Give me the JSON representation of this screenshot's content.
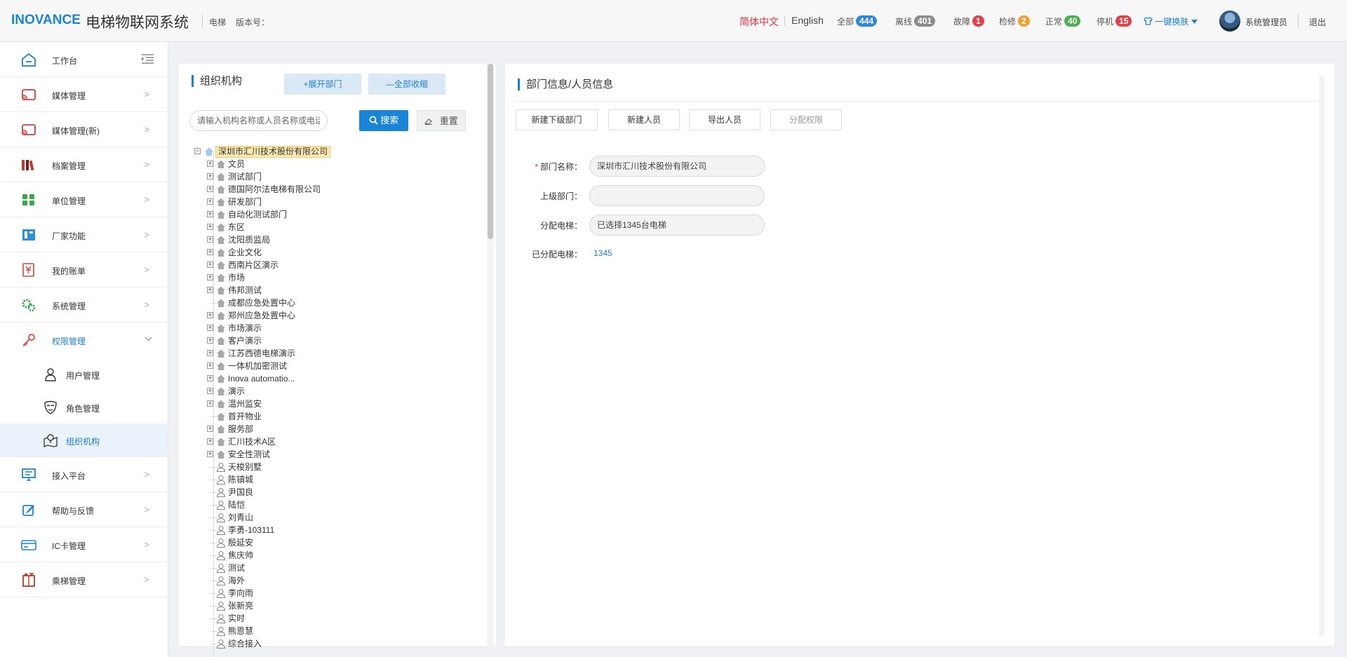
{
  "header": {
    "logo": "INOVANCE",
    "title": "电梯物联网系统",
    "crumb1": "电梯",
    "crumb2": "版本号：",
    "lang_cn": "简体中文",
    "lang_en": "English",
    "stats": [
      {
        "label": "全部",
        "value": "444",
        "color": "#2f89d8"
      },
      {
        "label": "离线",
        "value": "401",
        "color": "#8c8c8c"
      },
      {
        "label": "故障",
        "value": "1",
        "color": "#e0404a"
      },
      {
        "label": "检修",
        "value": "2",
        "color": "#f0a030"
      },
      {
        "label": "正常",
        "value": "40",
        "color": "#4cb050"
      },
      {
        "label": "停机",
        "value": "15",
        "color": "#e0404a"
      }
    ],
    "skin": "一键换肤",
    "user": "系统管理员",
    "logout": "退出"
  },
  "sidebar": {
    "items": [
      {
        "label": "工作台",
        "icon": "home-icon"
      },
      {
        "label": "媒体管理",
        "icon": "cast-icon"
      },
      {
        "label": "媒体管理(新)",
        "icon": "cast-icon"
      },
      {
        "label": "档案管理",
        "icon": "books-icon"
      },
      {
        "label": "单位管理",
        "icon": "apps-icon"
      },
      {
        "label": "厂家功能",
        "icon": "factory-icon"
      },
      {
        "label": "我的账单",
        "icon": "bill-icon"
      },
      {
        "label": "系统管理",
        "icon": "gears-icon"
      },
      {
        "label": "权限管理",
        "icon": "key-icon"
      }
    ],
    "sub_items": [
      {
        "label": "用户管理",
        "icon": "user-icon"
      },
      {
        "label": "角色管理",
        "icon": "mask-icon"
      },
      {
        "label": "组织机构",
        "icon": "map-pin-icon"
      }
    ],
    "items_after": [
      {
        "label": "接入平台",
        "icon": "monitor-icon"
      },
      {
        "label": "帮助与反馈",
        "icon": "edit-icon"
      },
      {
        "label": "IC卡管理",
        "icon": "card-icon"
      },
      {
        "label": "乘梯管理",
        "icon": "elevator-icon"
      }
    ]
  },
  "org_panel": {
    "title": "组织机构",
    "expand_label": "+展开部门",
    "collapse_label": "—全部收缩",
    "search_placeholder": "请输入机构名称或人员名称或电话号码",
    "search_label": "搜索",
    "reset_label": "重置",
    "root": "深圳市汇川技术股份有限公司",
    "departments": [
      {
        "name": "文员",
        "expandable": true
      },
      {
        "name": "测试部门",
        "expandable": true
      },
      {
        "name": "德国阿尔法电梯有限公司",
        "expandable": true
      },
      {
        "name": "研发部门",
        "expandable": true
      },
      {
        "name": "自动化测试部门",
        "expandable": true
      },
      {
        "name": "东区",
        "expandable": true
      },
      {
        "name": "沈阳质监局",
        "expandable": true
      },
      {
        "name": "企业文化",
        "expandable": true
      },
      {
        "name": "西南片区演示",
        "expandable": true
      },
      {
        "name": "市场",
        "expandable": true
      },
      {
        "name": "伟邦测试",
        "expandable": true
      },
      {
        "name": "成都应急处置中心",
        "expandable": false
      },
      {
        "name": "郑州应急处置中心",
        "expandable": true
      },
      {
        "name": "市场演示",
        "expandable": true
      },
      {
        "name": "客户演示",
        "expandable": true
      },
      {
        "name": "江苏西德电梯演示",
        "expandable": true
      },
      {
        "name": "一体机加密测试",
        "expandable": true
      },
      {
        "name": "Inova automatio...",
        "expandable": true
      },
      {
        "name": "演示",
        "expandable": true
      },
      {
        "name": "温州监安",
        "expandable": true
      },
      {
        "name": "首开物业",
        "expandable": false
      },
      {
        "name": "服务部",
        "expandable": true
      },
      {
        "name": "汇川技术A区",
        "expandable": true
      },
      {
        "name": "安全性测试",
        "expandable": true
      }
    ],
    "persons": [
      "天梭别墅",
      "陈镇城",
      "尹国良",
      "陆恺",
      "刘青山",
      "李勇-103111",
      "殷延安",
      "焦庆帅",
      "测试",
      "海外",
      "李向雨",
      "张新亮",
      "实时",
      "熊恩慧",
      "综合接入"
    ]
  },
  "info_panel": {
    "title": "部门信息/人员信息",
    "buttons": [
      "新建下级部门",
      "新建人员",
      "导出人员",
      "分配权限"
    ],
    "fields": {
      "dept_name_label": "部门名称：",
      "dept_name_value": "深圳市汇川技术股份有限公司",
      "parent_label": "上级部门：",
      "parent_value": "",
      "assign_label": "分配电梯：",
      "assign_value": "已选择1345台电梯",
      "assigned_label": "已分配电梯：",
      "assigned_value": "1345"
    }
  }
}
